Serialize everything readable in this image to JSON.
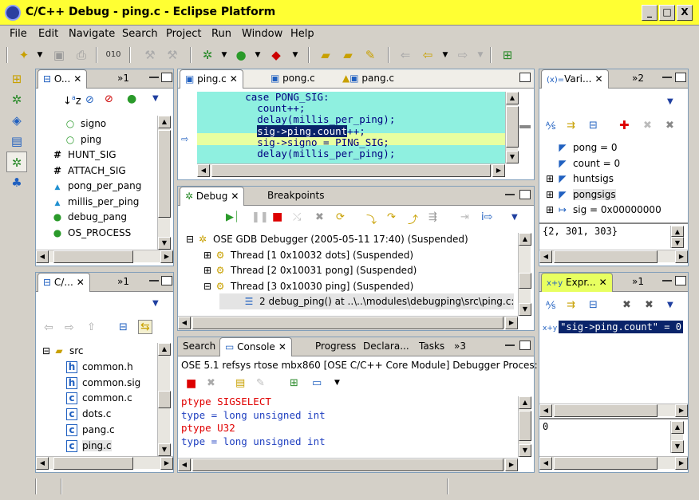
{
  "window": {
    "title": "C/C++ Debug - ping.c - Eclipse Platform",
    "min": "_",
    "max": "□",
    "close": "X"
  },
  "menu": [
    "File",
    "Edit",
    "Navigate",
    "Search",
    "Project",
    "Run",
    "Window",
    "Help"
  ],
  "outline": {
    "tab": "O...",
    "overflow": "»1",
    "items": [
      {
        "icon": "field-icon",
        "label": "signo",
        "indent": 1
      },
      {
        "icon": "field-icon",
        "label": "ping",
        "indent": 1
      },
      {
        "icon": "macro-icon",
        "label": "HUNT_SIG",
        "indent": 0
      },
      {
        "icon": "macro-icon",
        "label": "ATTACH_SIG",
        "indent": 0
      },
      {
        "icon": "static-var-icon",
        "label": "pong_per_pang",
        "indent": 0
      },
      {
        "icon": "static-var-icon",
        "label": "millis_per_ping",
        "indent": 0
      },
      {
        "icon": "function-icon",
        "label": "debug_pang",
        "indent": 0
      },
      {
        "icon": "function-icon",
        "label": "OS_PROCESS",
        "indent": 0
      }
    ]
  },
  "projects": {
    "tab": "C/...",
    "overflow": "»1",
    "items": [
      {
        "label": "src",
        "kind": "folder",
        "indent": 0
      },
      {
        "label": "common.h",
        "kind": "header",
        "indent": 1
      },
      {
        "label": "common.sig",
        "kind": "header",
        "indent": 1
      },
      {
        "label": "common.c",
        "kind": "source",
        "indent": 1
      },
      {
        "label": "dots.c",
        "kind": "source",
        "indent": 1
      },
      {
        "label": "pang.c",
        "kind": "source-warn",
        "indent": 1
      },
      {
        "label": "ping.c",
        "kind": "source",
        "indent": 1
      }
    ]
  },
  "editor": {
    "tabs": [
      "ping.c",
      "pong.c",
      "pang.c"
    ],
    "lines": [
      "        case PONG_SIG:",
      "          count++;",
      "          delay(millis_per_ping);",
      "          sig->ping.count++;",
      "          sig->signo = PING_SIG;",
      "          delay(millis_per_ping);"
    ],
    "selection": "sig->ping.count"
  },
  "debug": {
    "tabs": [
      "Debug",
      "Breakpoints"
    ],
    "items": [
      {
        "label": "OSE GDB Debugger (2005-05-11 17:40) (Suspended)",
        "indent": 0,
        "exp": "⊟"
      },
      {
        "label": "Thread [1 0x10032 dots] (Suspended)",
        "indent": 1,
        "exp": "⊞"
      },
      {
        "label": "Thread [2 0x10031 pong] (Suspended)",
        "indent": 1,
        "exp": "⊞"
      },
      {
        "label": "Thread [3 0x10030 ping] (Suspended)",
        "indent": 1,
        "exp": "⊟"
      },
      {
        "label": "2 debug_ping() at ..\\..\\modules\\debugping\\src\\ping.c:",
        "indent": 2,
        "exp": ""
      }
    ]
  },
  "console": {
    "tabs": [
      "Search",
      "Console",
      "Progress",
      "Declara...",
      "Tasks",
      "»3"
    ],
    "header": "OSE 5.1 refsys rtose mbx860 [OSE C/C++ Core Module] Debugger Proces:",
    "lines": [
      {
        "text": "ptype SIGSELECT",
        "color": "#e00000"
      },
      {
        "text": "type = long unsigned int",
        "color": "#2040c0"
      },
      {
        "text": "ptype U32",
        "color": "#e00000"
      },
      {
        "text": "type = long unsigned int",
        "color": "#2040c0"
      }
    ]
  },
  "variables": {
    "tab": "Vari...",
    "overflow": "»2",
    "items": [
      {
        "label": "pong = 0",
        "exp": ""
      },
      {
        "label": "count = 0",
        "exp": ""
      },
      {
        "label": "huntsigs",
        "exp": "⊞"
      },
      {
        "label": "pongsigs",
        "exp": "⊞"
      },
      {
        "label": "sig = 0x00000000",
        "exp": "⊞"
      }
    ],
    "detail": "{2, 301, 303}"
  },
  "expressions": {
    "tab": "Expr...",
    "overflow": "»1",
    "item": "\"sig->ping.count\" = 0",
    "detail": "0"
  }
}
